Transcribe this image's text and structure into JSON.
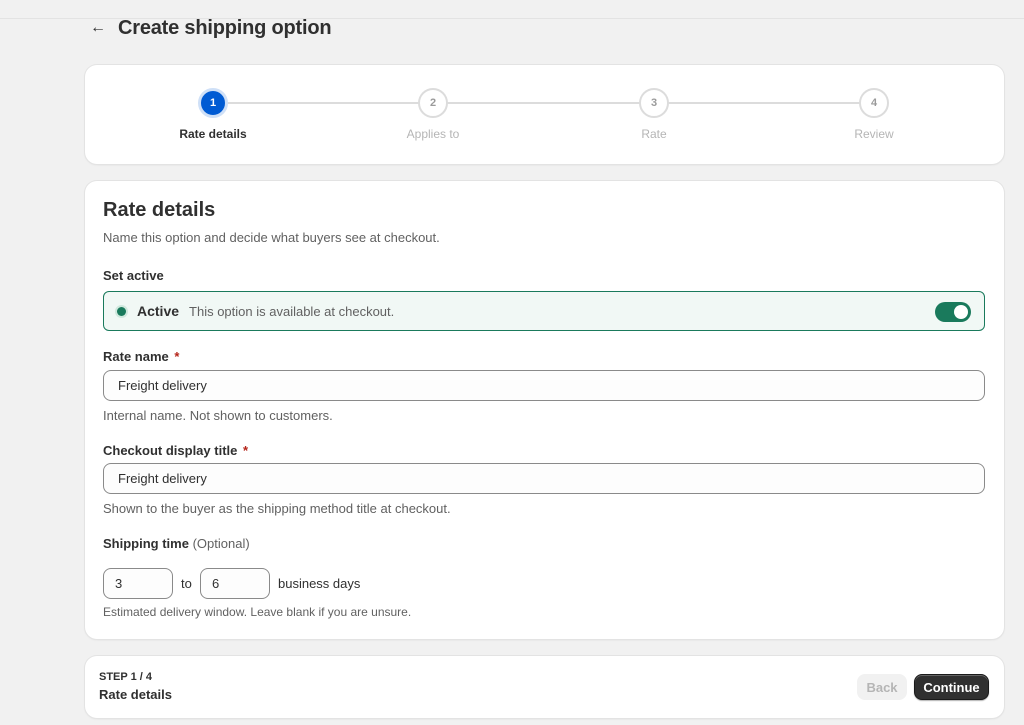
{
  "header": {
    "title": "Create shipping option"
  },
  "stepper": {
    "steps": [
      {
        "number": "1",
        "label": "Rate details",
        "state": "active"
      },
      {
        "number": "2",
        "label": "Applies to",
        "state": "upcoming"
      },
      {
        "number": "3",
        "label": "Rate",
        "state": "upcoming"
      },
      {
        "number": "4",
        "label": "Review",
        "state": "upcoming"
      }
    ]
  },
  "form": {
    "title": "Rate details",
    "description": "Name this option and decide what buyers see at checkout.",
    "set_active": {
      "label": "Set active",
      "status_title": "Active",
      "status_description": "This option is available at checkout.",
      "enabled": true
    },
    "rate_name": {
      "label": "Rate name",
      "required_mark": "*",
      "value": "Freight delivery",
      "help": "Internal name. Not shown to customers."
    },
    "checkout_title": {
      "label": "Checkout display title",
      "required_mark": "*",
      "value": "Freight delivery",
      "help": "Shown to the buyer as the shipping method title at checkout."
    },
    "shipping_time": {
      "label": "Shipping time",
      "optional": "(Optional)",
      "min": "3",
      "separator": "to",
      "max": "6",
      "unit": "business days",
      "help": "Estimated delivery window. Leave blank if you are unsure."
    }
  },
  "footer": {
    "step_count": "STEP 1 / 4",
    "step_name": "Rate details",
    "back_label": "Back",
    "continue_label": "Continue"
  },
  "colors": {
    "primary": "#005bd3",
    "success": "#1a7a5c",
    "dark_button": "#303030"
  },
  "icons": {
    "back": "arrow-left-icon",
    "status": "status-dot-icon"
  }
}
